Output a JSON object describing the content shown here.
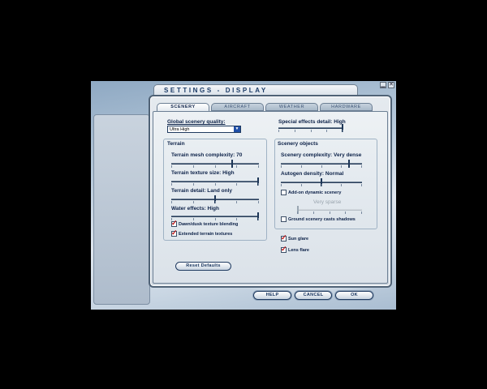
{
  "window": {
    "title": "SETTINGS - DISPLAY",
    "min_icon": "minimize-icon",
    "close_icon": "close-icon",
    "min_glyph": "▁",
    "close_glyph": "✕"
  },
  "tabs": [
    {
      "label": "SCENERY",
      "active": true
    },
    {
      "label": "AIRCRAFT",
      "active": false
    },
    {
      "label": "WEATHER",
      "active": false
    },
    {
      "label": "HARDWARE",
      "active": false
    }
  ],
  "scenery": {
    "global_quality_label": "Global scenery quality:",
    "global_quality_value": "Ultra High",
    "special_effects_label": "Special effects detail: High",
    "special_effects_level": 1.0,
    "terrain": {
      "heading": "Terrain",
      "mesh_label": "Terrain mesh complexity: 70",
      "mesh_level": 0.7,
      "texture_label": "Terrain texture size: High",
      "texture_level": 1.0,
      "detail_label": "Terrain detail: Land only",
      "detail_level": 0.5,
      "water_label": "Water effects: High",
      "water_level": 1.0,
      "dawn_dusk_label": "Dawn/dusk texture blending",
      "dawn_dusk_checked": true,
      "extended_label": "Extended terrain textures",
      "extended_checked": true
    },
    "objects": {
      "heading": "Scenery objects",
      "complexity_label": "Scenery complexity: Very dense",
      "complexity_level": 0.85,
      "autogen_label": "Autogen density: Normal",
      "autogen_level": 0.5,
      "addon_label": "Add-on dynamic scenery",
      "addon_checked": false,
      "addon_value_label": "Very sparse",
      "addon_level": 0.0,
      "shadows_label": "Ground scenery casts shadows",
      "shadows_checked": false
    },
    "sun_glare_label": "Sun glare",
    "sun_glare_checked": true,
    "lens_flare_label": "Lens flare",
    "lens_flare_checked": true,
    "reset_label": "Reset Defaults"
  },
  "buttons": {
    "help": "HELP",
    "cancel": "CANCEL",
    "ok": "OK"
  }
}
